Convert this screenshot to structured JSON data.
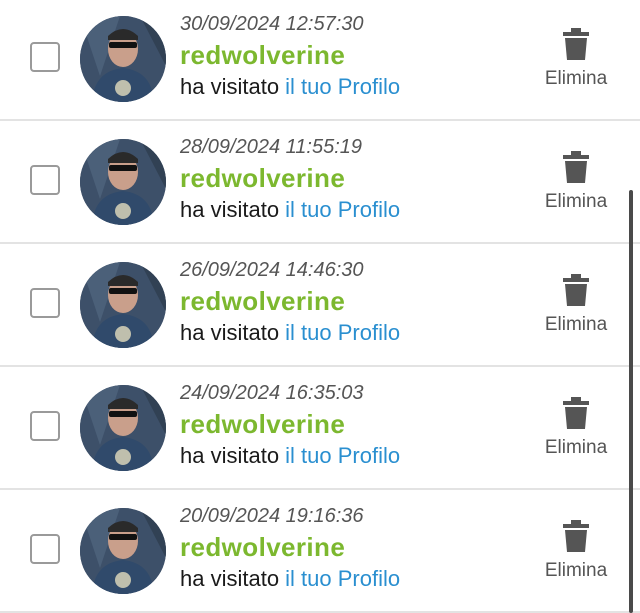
{
  "notifications": [
    {
      "timestamp": "30/09/2024 12:57:30",
      "username": "redwolverine",
      "action_text": "ha visitato ",
      "link_text": "il tuo Profilo",
      "delete_label": "Elimina"
    },
    {
      "timestamp": "28/09/2024 11:55:19",
      "username": "redwolverine",
      "action_text": "ha visitato ",
      "link_text": "il tuo Profilo",
      "delete_label": "Elimina"
    },
    {
      "timestamp": "26/09/2024 14:46:30",
      "username": "redwolverine",
      "action_text": "ha visitato ",
      "link_text": "il tuo Profilo",
      "delete_label": "Elimina"
    },
    {
      "timestamp": "24/09/2024 16:35:03",
      "username": "redwolverine",
      "action_text": "ha visitato ",
      "link_text": "il tuo Profilo",
      "delete_label": "Elimina"
    },
    {
      "timestamp": "20/09/2024 19:16:36",
      "username": "redwolverine",
      "action_text": "ha visitato ",
      "link_text": "il tuo Profilo",
      "delete_label": "Elimina"
    }
  ],
  "colors": {
    "username": "#7cb82f",
    "link": "#2a8fd0",
    "icon": "#555555"
  },
  "icons": {
    "delete": "trash-icon",
    "avatar": "user-avatar"
  }
}
